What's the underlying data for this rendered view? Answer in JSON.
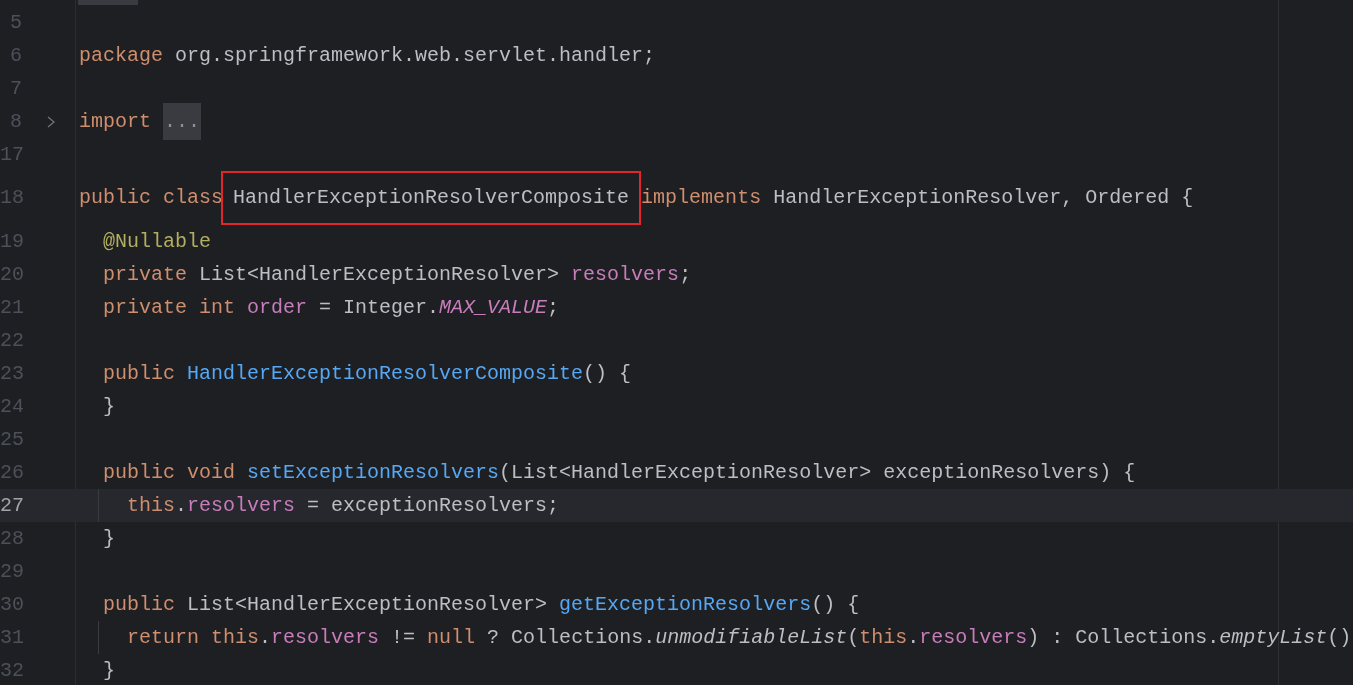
{
  "editor": {
    "lines": [
      {
        "number": "5",
        "current": false
      },
      {
        "number": "6",
        "current": false,
        "tokens": [
          {
            "kind": "keyword",
            "text": "package "
          },
          {
            "kind": "plain",
            "text": "org.springframework.web.servlet.handler;"
          }
        ]
      },
      {
        "number": "7",
        "current": false
      },
      {
        "number": "8",
        "current": false,
        "folded": true,
        "tokens": [
          {
            "kind": "keyword",
            "text": "import "
          },
          {
            "kind": "folded",
            "text": "..."
          }
        ]
      },
      {
        "number": "17",
        "current": false
      },
      {
        "number": "18",
        "current": false,
        "tokens": [
          {
            "kind": "keyword",
            "text": "public class "
          },
          {
            "kind": "boxed",
            "text": "HandlerExceptionResolverComposite"
          },
          {
            "kind": "keyword",
            "text": "implements "
          },
          {
            "kind": "plain",
            "text": "HandlerExceptionResolver, Ordered {"
          }
        ]
      },
      {
        "number": "19",
        "current": false,
        "tokens": [
          {
            "kind": "annotation",
            "text": "  @Nullable"
          }
        ]
      },
      {
        "number": "20",
        "current": false,
        "tokens": [
          {
            "kind": "keyword",
            "text": "  private "
          },
          {
            "kind": "plain",
            "text": "List<HandlerExceptionResolver> "
          },
          {
            "kind": "field",
            "text": "resolvers"
          },
          {
            "kind": "plain",
            "text": ";"
          }
        ]
      },
      {
        "number": "21",
        "current": false,
        "tokens": [
          {
            "kind": "keyword",
            "text": "  private int "
          },
          {
            "kind": "field",
            "text": "order"
          },
          {
            "kind": "plain",
            "text": " = Integer."
          },
          {
            "kind": "static",
            "text": "MAX_VALUE"
          },
          {
            "kind": "plain",
            "text": ";"
          }
        ]
      },
      {
        "number": "22",
        "current": false
      },
      {
        "number": "23",
        "current": false,
        "tokens": [
          {
            "kind": "keyword",
            "text": "  public "
          },
          {
            "kind": "method",
            "text": "HandlerExceptionResolverComposite"
          },
          {
            "kind": "plain",
            "text": "() {"
          }
        ]
      },
      {
        "number": "24",
        "current": false,
        "tokens": [
          {
            "kind": "plain",
            "text": "  }"
          }
        ]
      },
      {
        "number": "25",
        "current": false
      },
      {
        "number": "26",
        "current": false,
        "tokens": [
          {
            "kind": "keyword",
            "text": "  public void "
          },
          {
            "kind": "method",
            "text": "setExceptionResolvers"
          },
          {
            "kind": "plain",
            "text": "(List<HandlerExceptionResolver> exceptionResolvers) {"
          }
        ]
      },
      {
        "number": "27",
        "current": true,
        "tokens": [
          {
            "kind": "keyword",
            "text": "    this"
          },
          {
            "kind": "plain",
            "text": "."
          },
          {
            "kind": "field",
            "text": "resolvers"
          },
          {
            "kind": "plain",
            "text": " = exceptionResolvers;"
          }
        ]
      },
      {
        "number": "28",
        "current": false,
        "tokens": [
          {
            "kind": "plain",
            "text": "  }"
          }
        ]
      },
      {
        "number": "29",
        "current": false
      },
      {
        "number": "30",
        "current": false,
        "tokens": [
          {
            "kind": "keyword",
            "text": "  public "
          },
          {
            "kind": "plain",
            "text": "List<HandlerExceptionResolver> "
          },
          {
            "kind": "method",
            "text": "getExceptionResolvers"
          },
          {
            "kind": "plain",
            "text": "() {"
          }
        ]
      },
      {
        "number": "31",
        "current": false,
        "tokens": [
          {
            "kind": "keyword",
            "text": "    return this"
          },
          {
            "kind": "plain",
            "text": "."
          },
          {
            "kind": "field",
            "text": "resolvers"
          },
          {
            "kind": "plain",
            "text": " != "
          },
          {
            "kind": "keyword",
            "text": "null"
          },
          {
            "kind": "plain",
            "text": " ? Collections."
          },
          {
            "kind": "static-call",
            "text": "unmodifiableList"
          },
          {
            "kind": "plain",
            "text": "("
          },
          {
            "kind": "keyword",
            "text": "this"
          },
          {
            "kind": "plain",
            "text": "."
          },
          {
            "kind": "field",
            "text": "resolvers"
          },
          {
            "kind": "plain",
            "text": ") : Collections."
          },
          {
            "kind": "static-call",
            "text": "emptyList"
          },
          {
            "kind": "plain",
            "text": "()"
          }
        ]
      },
      {
        "number": "32",
        "current": false,
        "tokens": [
          {
            "kind": "plain",
            "text": "  }"
          }
        ]
      }
    ]
  }
}
